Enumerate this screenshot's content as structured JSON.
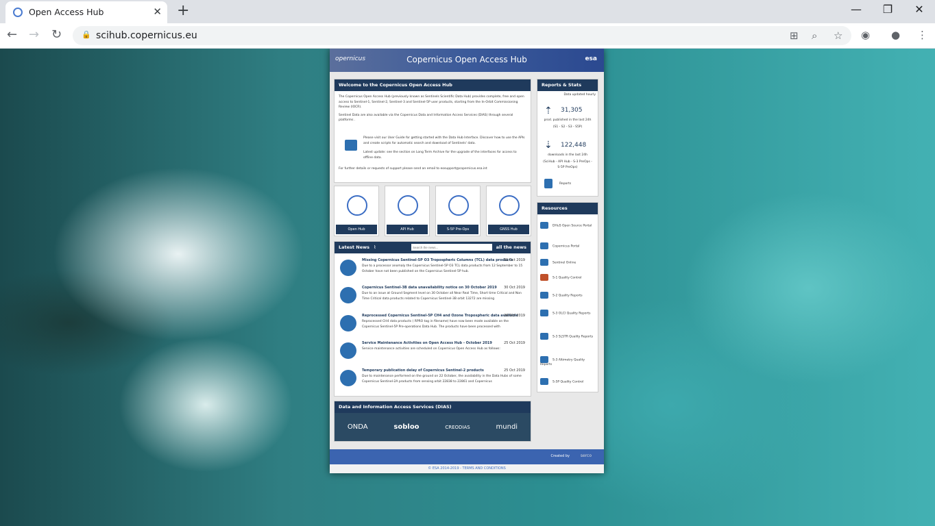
{
  "browser": {
    "tab_title": "Open Access Hub",
    "url": "scihub.copernicus.eu"
  },
  "site": {
    "header": {
      "logo": "opernicus",
      "title": "Copernicus Open Access Hub",
      "esa": "esa"
    },
    "welcome": {
      "heading": "Welcome to the Copernicus Open Access Hub",
      "p1": "The Copernicus Open Access Hub (previously known as Sentinels Scientific Data Hub) provides complete, free and open access to Sentinel-1, Sentinel-2, Sentinel-3 and Sentinel-5P user products, starting from the In-Orbit Commissioning Review (IOCR).",
      "p2": "Sentinel Data are also available via the Copernicus Data and Information Access Services (DIAS) through several platforms .",
      "p3": "Please visit our User Guide for getting started with the Data Hub Interface. Discover how to use the APIs and create scripts for automatic search and download of Sentinels' data.",
      "p4": "Latest update: see the section on Long Term Archive for the upgrade of the interfaces for access to offline data.",
      "p5": "For further details or requests of support please send an email to eosupport@copernicus.esa.int"
    },
    "hubs": [
      "Open Hub",
      "API Hub",
      "S-5P Pre-Ops",
      "GNSS Hub"
    ],
    "news": {
      "heading": "Latest News",
      "search_placeholder": "Search the news...",
      "all_label": "all the news",
      "items": [
        {
          "title": "Missing Copernicus Sentinel-5P O3 Tropospheric Columns (TCL) data products",
          "date": "31 Oct 2019",
          "text": "Due to a processor anomaly the Copernicus Sentinel-5P O3 TCL data products from 12 September to 15 October have not been published on the Copernicus Sentinel-5P hub."
        },
        {
          "title": "Copernicus Sentinel-3B data unavailability notice on 30 October 2019",
          "date": "30 Oct 2019",
          "text": "Due to an issue at Ground Segment level on 30 October all Near Real Time, Short time Critical and Non Time Critical data products related to Copernicus Sentinel-3B orbit 13272 are missing"
        },
        {
          "title": "Reprocessed Copernicus Sentinel-5P CH4 and Ozone Tropospheric data available",
          "date": "29 Oct 2019",
          "text": "Reprocessed CH4 data products ( RPRO tag in filename) have now been made available on the Copernicus Sentinel-5P Pre-operations Data Hub. The products have been processed with"
        },
        {
          "title": "Service Maintenance Activities on Open Access Hub - October 2019",
          "date": "25 Oct 2019",
          "text": "Service maintenance activities are scheduled on Copernicus Open Access Hub as follows:"
        },
        {
          "title": "Temporary publication delay of Copernicus Sentinel-2 products",
          "date": "25 Oct 2019",
          "text": "Due to maintenance performed on the ground on 22 October, the availability in the Data Hubs of some Copernicus Sentinel-2A products from sensing orbit 22838 to 22861 and Copernicus"
        }
      ]
    },
    "dias": {
      "heading": "Data and Information Access Services (DIAS)",
      "providers": [
        "ONDA",
        "sobloo",
        "CREODIAS",
        "mundi"
      ]
    },
    "stats": {
      "heading": "Reports & Stats",
      "updated": "Data updated hourly",
      "pub_count": "31,305",
      "pub_label": "prod. published in the last 24h",
      "pub_sub": "(S1 - S2 - S3 - S5P)",
      "dl_count": "122,448",
      "dl_label": "downloads in the last 24h",
      "dl_sub": "(SciHub - API Hub - S-3 PreOps - S-5P PreOps)",
      "reports": "Reports"
    },
    "resources": {
      "heading": "Resources",
      "items": [
        "DHuS Open Source Portal",
        "Copernicus Portal",
        "Sentinel Online",
        "S-1 Quality Control",
        "S-2 Quality Reports",
        "S-3 OLCI Quality Reports",
        "S-3 SLSTR Quality Reports",
        "S-3 Altimetry Quality Reports",
        "S-5P Quality Control"
      ]
    },
    "footer": {
      "created_by": "Created by",
      "serco": "serco",
      "copyright": "© ESA 2014-2019 - TERMS AND CONDITIONS"
    }
  }
}
